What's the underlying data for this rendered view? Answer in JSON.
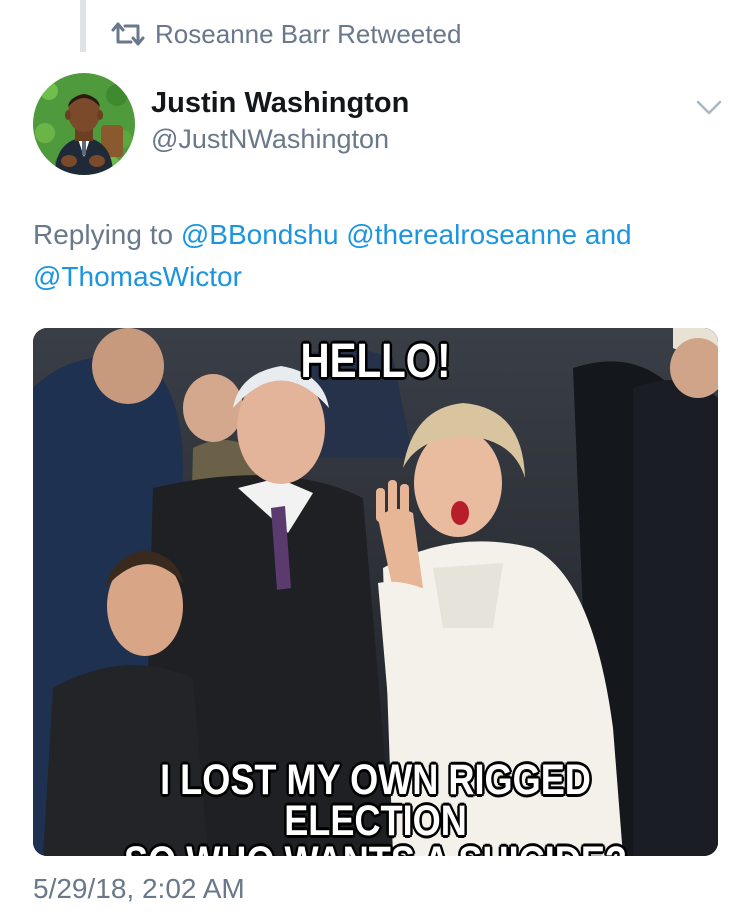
{
  "retweet": {
    "label": "Roseanne Barr Retweeted"
  },
  "author": {
    "name": "Justin Washington",
    "handle": "@JustNWashington"
  },
  "reply": {
    "prefix": "Replying to",
    "mention1": "@BBondshu",
    "mention2": "@therealroseanne",
    "conjunction": "and",
    "mention3": "@ThomasWictor"
  },
  "meme": {
    "top_text": "HELLO!",
    "bottom_line1": "I LOST MY OWN RIGGED ELECTION",
    "bottom_line2": "SO WHO WANTS A SUICIDE?"
  },
  "tweet": {
    "timestamp": "5/29/18, 2:02 AM"
  },
  "icons": {
    "retweet": "retweet-icon",
    "more": "chevron-down-icon"
  },
  "colors": {
    "link": "#1b95e0",
    "secondary_text": "#69788a",
    "primary_text": "#14171a"
  }
}
